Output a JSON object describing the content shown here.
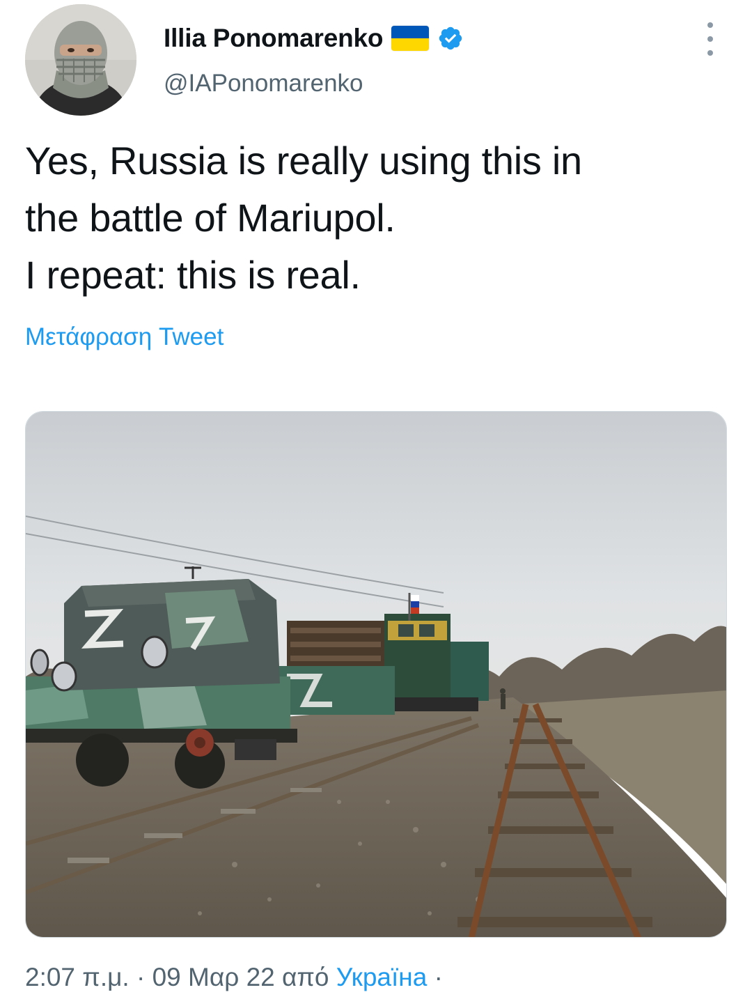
{
  "author": {
    "name": "Illia Ponomarenko",
    "handle": "@IAPonomarenko",
    "flag": "ukraine-flag-icon",
    "verified": true
  },
  "tweet": {
    "lines": [
      "Yes, Russia is really using this in",
      "the battle of Mariupol.",
      "I repeat: this is real."
    ],
    "translate_label": "Μετάφραση Tweet"
  },
  "meta": {
    "time": "2:07 π.μ.",
    "separator": "·",
    "date": "09 Μαρ 22",
    "from_label": "από",
    "source": "Україна",
    "trailing_separator": "·"
  },
  "colors": {
    "link": "#1d9bf0",
    "secondary_text": "#536471",
    "primary_text": "#0f1419",
    "verified": "#1d9bf0",
    "flag_blue": "#0057b7",
    "flag_yellow": "#ffd700"
  },
  "media": {
    "description_icon": "armored-train-photo"
  }
}
